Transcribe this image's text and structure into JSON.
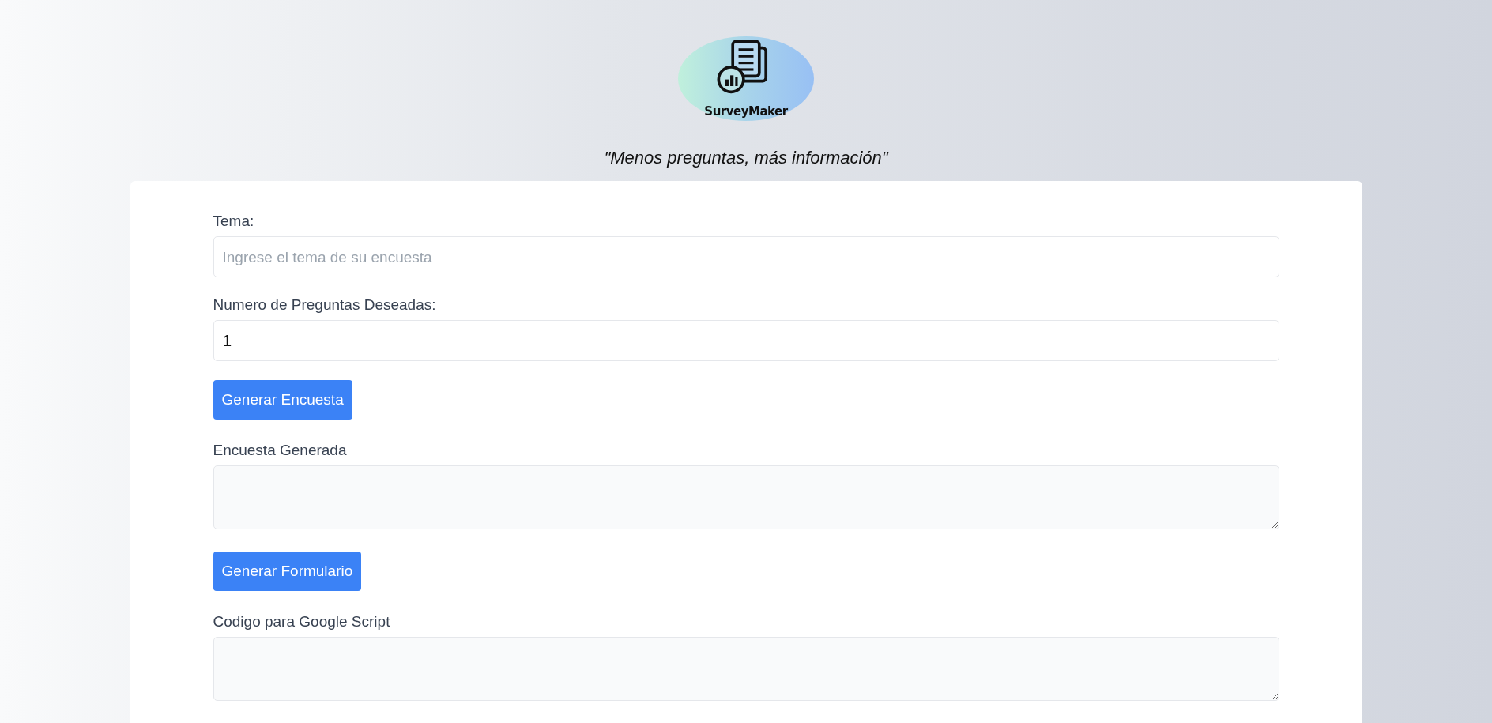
{
  "logo": {
    "text": "SurveyMaker"
  },
  "tagline": "\"Menos preguntas, más información\"",
  "form": [
    {
      "kind": "input",
      "label": "Tema:",
      "placeholder": "Ingrese el tema de su encuesta"
    },
    {
      "kind": "input",
      "label": "Numero de Preguntas Deseadas:",
      "value": "1"
    },
    {
      "kind": "button",
      "label": "Generar Encuesta"
    },
    {
      "kind": "textarea",
      "label": "Encuesta Generada"
    },
    {
      "kind": "button",
      "label": "Generar Formulario"
    },
    {
      "kind": "textarea",
      "label": "Codigo para Google Script"
    }
  ]
}
